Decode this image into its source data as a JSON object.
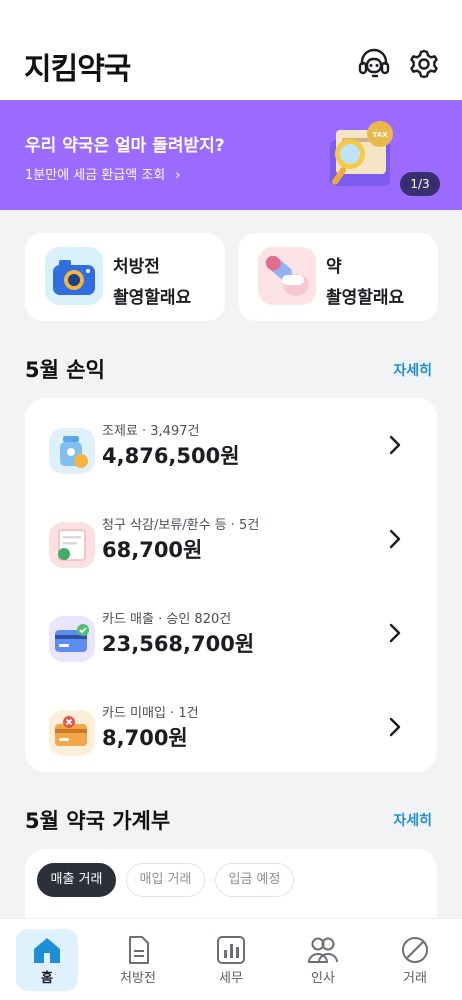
{
  "header": {
    "title": "지킴약국",
    "icons": [
      "headset-icon",
      "gear-icon"
    ]
  },
  "banner": {
    "title": "우리 약국은 얼마 돌려받지?",
    "subtitle": "1분만에 세금 환급액 조회",
    "chevron": "›",
    "counter": "1/3",
    "illustration_text": "TAX",
    "color": "#9b6bff"
  },
  "quick_actions": [
    {
      "line1": "처방전",
      "line2": "촬영할래요",
      "icon": "camera-icon"
    },
    {
      "line1": "약",
      "line2": "촬영할래요",
      "icon": "pills-icon"
    }
  ],
  "profit_section": {
    "title": "5월 손익",
    "more": "자세히",
    "rows": [
      {
        "label": "조제료 · 3,497건",
        "amount": "4,876,500원",
        "icon": "medicine-bottle-icon"
      },
      {
        "label": "청구 삭감/보류/환수 등 ·  5건",
        "amount": "68,700원",
        "icon": "claim-document-icon"
      },
      {
        "label": "카드 매출 ·  승인 820건",
        "amount": "23,568,700원",
        "icon": "credit-card-icon"
      },
      {
        "label": "카드 미매입 ·  1건",
        "amount": "8,700원",
        "icon": "card-pending-icon"
      }
    ]
  },
  "ledger_section": {
    "title": "5월 약국 가계부",
    "more": "자세히",
    "filters": [
      {
        "label": "매출 거래",
        "active": true
      },
      {
        "label": "매입 거래",
        "active": false
      },
      {
        "label": "입금 예정",
        "active": false
      }
    ]
  },
  "tabbar": [
    {
      "label": "홈",
      "icon": "home-icon",
      "active": true
    },
    {
      "label": "처방전",
      "icon": "prescription-icon",
      "active": false
    },
    {
      "label": "세무",
      "icon": "tax-chart-icon",
      "active": false
    },
    {
      "label": "인사",
      "icon": "people-icon",
      "active": false
    },
    {
      "label": "거래",
      "icon": "pill-capsule-icon",
      "active": false
    }
  ],
  "colors": {
    "accent": "#1e8fd6",
    "dark_chip": "#2b3039",
    "tab_active_bg": "#dff2fb"
  }
}
